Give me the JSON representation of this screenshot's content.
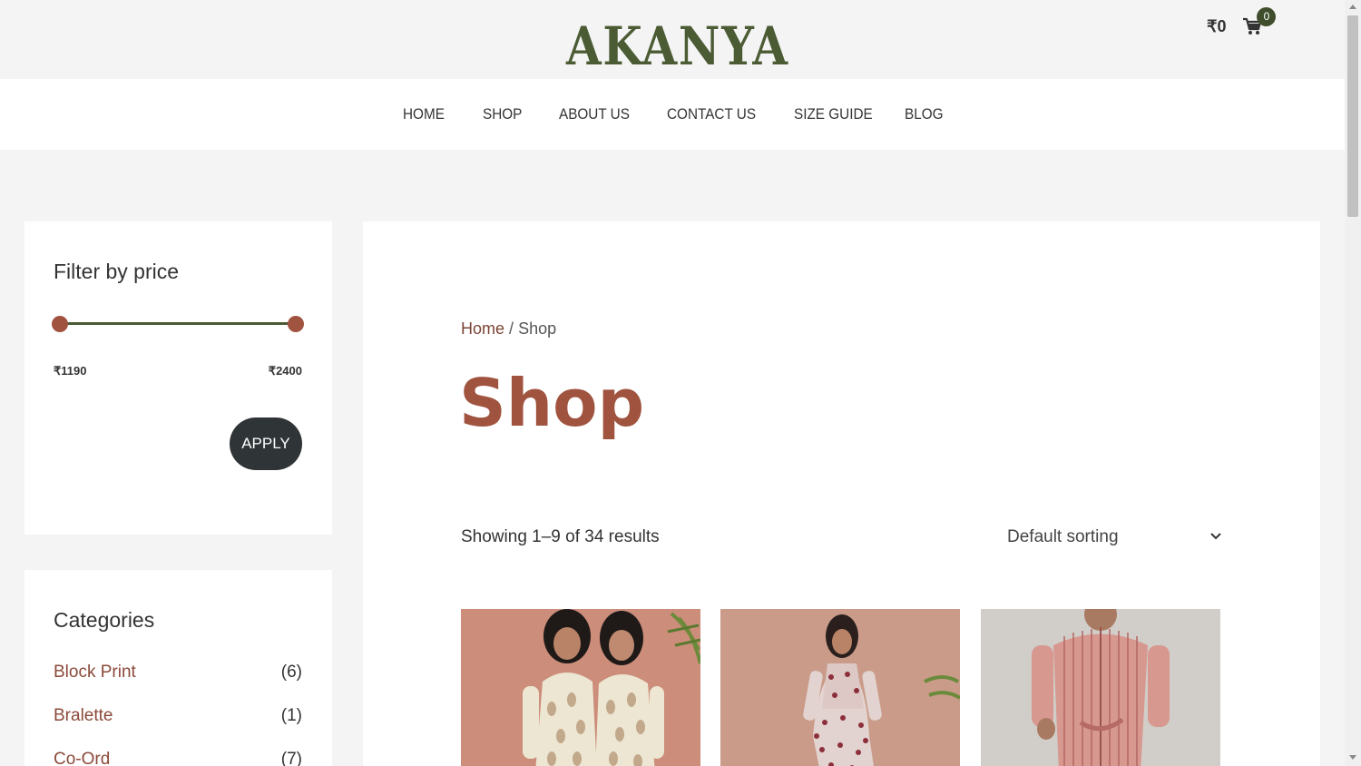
{
  "header": {
    "logo": "AKANYA",
    "cart_total": "₹0",
    "cart_count": "0"
  },
  "nav": {
    "items": [
      "HOME",
      "SHOP",
      "ABOUT US",
      "CONTACT US",
      "SIZE GUIDE",
      "BLOG"
    ]
  },
  "filter": {
    "title": "Filter by price",
    "min_price": "₹1190",
    "max_price": "₹2400",
    "apply_label": "APPLY"
  },
  "categories": {
    "title": "Categories",
    "items": [
      {
        "name": "Block Print",
        "count": "(6)"
      },
      {
        "name": "Bralette",
        "count": "(1)"
      },
      {
        "name": "Co-Ord",
        "count": "(7)"
      }
    ]
  },
  "breadcrumb": {
    "home": "Home",
    "separator": "/",
    "current": "Shop"
  },
  "main": {
    "title": "Shop",
    "result_count": "Showing 1–9 of 34 results",
    "sort_label": "Default sorting"
  },
  "colors": {
    "brand_green": "#4b5b34",
    "accent_rust": "#a0533f",
    "button_dark": "#2f3437"
  }
}
